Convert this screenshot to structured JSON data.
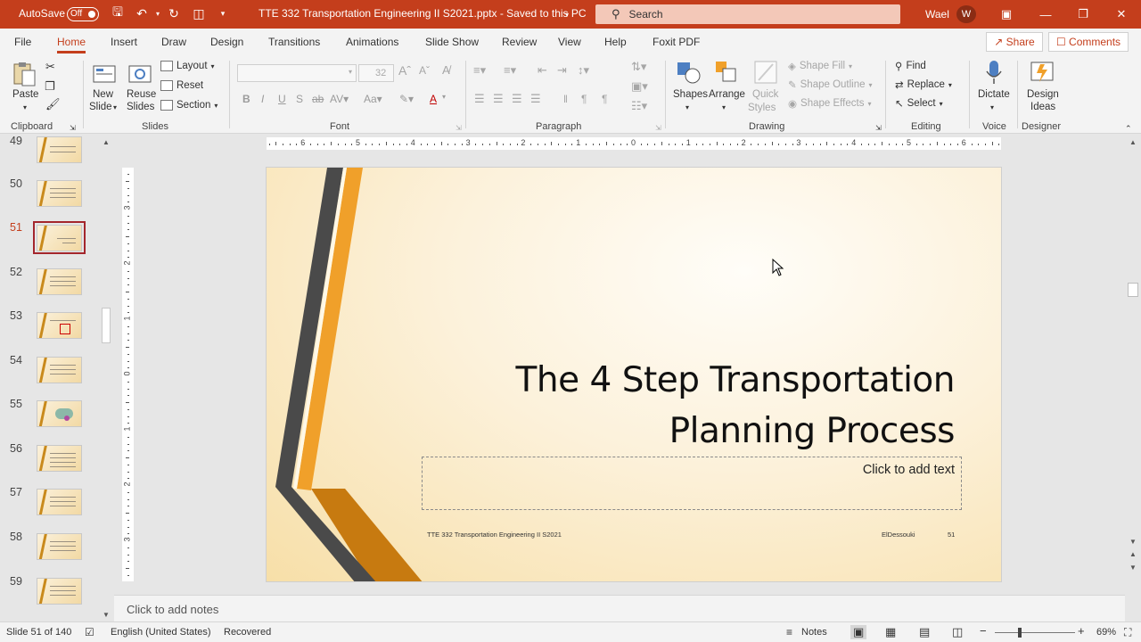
{
  "titlebar": {
    "autosave_label": "AutoSave",
    "autosave_state": "Off",
    "document_title": "TTE 332 Transportation Engineering II  S2021.pptx  -  Saved to this PC",
    "search_placeholder": "Search",
    "user_name": "Wael",
    "user_initial": "W"
  },
  "menu": {
    "tabs": [
      "File",
      "Home",
      "Insert",
      "Draw",
      "Design",
      "Transitions",
      "Animations",
      "Slide Show",
      "Review",
      "View",
      "Help",
      "Foxit PDF"
    ],
    "active": "Home",
    "share": "Share",
    "comments": "Comments"
  },
  "ribbon": {
    "clipboard": {
      "paste": "Paste",
      "label": "Clipboard"
    },
    "slides": {
      "new_slide_1": "New",
      "new_slide_2": "Slide",
      "reuse_1": "Reuse",
      "reuse_2": "Slides",
      "layout": "Layout",
      "reset": "Reset",
      "section": "Section",
      "label": "Slides"
    },
    "font": {
      "size": "32",
      "label": "Font"
    },
    "paragraph": {
      "label": "Paragraph"
    },
    "drawing": {
      "shapes": "Shapes",
      "arrange": "Arrange",
      "quick_1": "Quick",
      "quick_2": "Styles",
      "shape_fill": "Shape Fill",
      "shape_outline": "Shape Outline",
      "shape_effects": "Shape Effects",
      "label": "Drawing"
    },
    "editing": {
      "find": "Find",
      "replace": "Replace",
      "select": "Select",
      "label": "Editing"
    },
    "voice": {
      "dictate": "Dictate",
      "label": "Voice"
    },
    "designer": {
      "ideas_1": "Design",
      "ideas_2": "Ideas",
      "label": "Designer"
    }
  },
  "thumbnails": {
    "numbers": [
      "49",
      "50",
      "51",
      "52",
      "53",
      "54",
      "55",
      "56",
      "57",
      "58",
      "59"
    ],
    "selected": "51"
  },
  "ruler": {
    "h_labels": [
      "6",
      "5",
      "4",
      "3",
      "2",
      "1",
      "0",
      "1",
      "2",
      "3",
      "4",
      "5",
      "6"
    ],
    "v_labels": [
      "3",
      "2",
      "1",
      "0",
      "1",
      "2",
      "3"
    ]
  },
  "slide": {
    "title_line1": "The 4 Step Transportation",
    "title_line2": "Planning Process",
    "subtitle_placeholder": "Click to add text",
    "footer_left": "TTE 332 Transportation Engineering II   S2021",
    "footer_right": "ElDessouki",
    "slide_number": "51",
    "colors": {
      "stripe_dark": "#4a4a4a",
      "stripe_orange": "#f0a02a",
      "stripe_dark_orange": "#c77a10"
    }
  },
  "notes": {
    "placeholder": "Click to add notes"
  },
  "status": {
    "slide_info": "Slide 51 of 140",
    "language": "English (United States)",
    "recovered": "Recovered",
    "notes": "Notes",
    "zoom": "69%"
  },
  "colors": {
    "accent": "#c43e1c"
  }
}
